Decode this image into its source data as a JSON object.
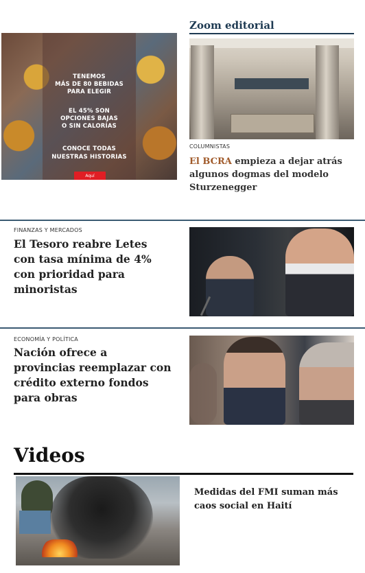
{
  "ad": {
    "line1": "TENEMOS",
    "line2": "MÁS DE 80 BEBIDAS",
    "line3": "PARA ELEGIR",
    "line4": "EL 45% SON",
    "line5": "OPCIONES BAJAS",
    "line6": "O SIN CALORÍAS",
    "line7": "CONOCE TODAS",
    "line8": "NUESTRAS HISTORIAS",
    "cta": "Aquí"
  },
  "zoom": {
    "section_title": "Zoom editorial",
    "kicker": "COLUMNISTAS",
    "headline_accent": "El BCRA",
    "headline_rest": " empieza a dejar atrás algunos dogmas del modelo Sturzenegger"
  },
  "finanzas": {
    "kicker": "FINANZAS Y MERCADOS",
    "headline": "El Tesoro reabre Letes con tasa mínima de 4% con prioridad para minoristas"
  },
  "economia": {
    "kicker": "ECONOMÍA Y POLÍTICA",
    "headline": "Nación ofrece a provincias reemplazar con crédito externo fondos para obras"
  },
  "videos": {
    "section_title": "Videos",
    "headline": "Medidas del FMI suman más caos social en Haití"
  },
  "colors": {
    "navy_rule": "#1e3a52",
    "accent": "#a05a2a",
    "cta_red": "#e01e24"
  }
}
